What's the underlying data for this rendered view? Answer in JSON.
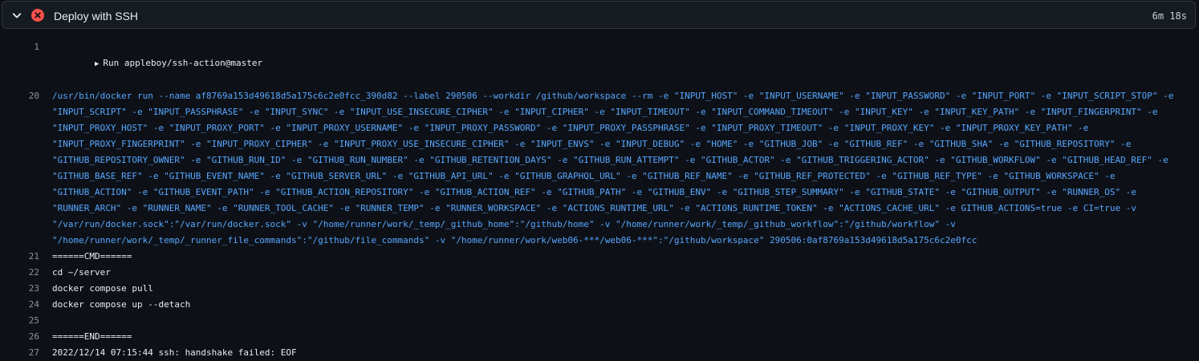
{
  "step": {
    "title": "Deploy with SSH",
    "duration": "6m 18s",
    "status": "failed",
    "status_color": "#f85149",
    "icons": {
      "expand": "chevron-down-icon",
      "status": "x-circle-fill-icon",
      "group": "triangle-right-icon"
    }
  },
  "log": {
    "lines": [
      {
        "number": "1",
        "text": "Run appleboy/ssh-action@master"
      },
      {
        "number": "20",
        "text": "/usr/bin/docker run --name af8769a153d49618d5a175c6c2e0fcc_390d82 --label 290506 --workdir /github/workspace --rm -e \"INPUT_HOST\" -e \"INPUT_USERNAME\" -e \"INPUT_PASSWORD\" -e \"INPUT_PORT\" -e \"INPUT_SCRIPT_STOP\" -e \"INPUT_SCRIPT\" -e \"INPUT_PASSPHRASE\" -e \"INPUT_SYNC\" -e \"INPUT_USE_INSECURE_CIPHER\" -e \"INPUT_CIPHER\" -e \"INPUT_TIMEOUT\" -e \"INPUT_COMMAND_TIMEOUT\" -e \"INPUT_KEY\" -e \"INPUT_KEY_PATH\" -e \"INPUT_FINGERPRINT\" -e \"INPUT_PROXY_HOST\" -e \"INPUT_PROXY_PORT\" -e \"INPUT_PROXY_USERNAME\" -e \"INPUT_PROXY_PASSWORD\" -e \"INPUT_PROXY_PASSPHRASE\" -e \"INPUT_PROXY_TIMEOUT\" -e \"INPUT_PROXY_KEY\" -e \"INPUT_PROXY_KEY_PATH\" -e \"INPUT_PROXY_FINGERPRINT\" -e \"INPUT_PROXY_CIPHER\" -e \"INPUT_PROXY_USE_INSECURE_CIPHER\" -e \"INPUT_ENVS\" -e \"INPUT_DEBUG\" -e \"HOME\" -e \"GITHUB_JOB\" -e \"GITHUB_REF\" -e \"GITHUB_SHA\" -e \"GITHUB_REPOSITORY\" -e \"GITHUB_REPOSITORY_OWNER\" -e \"GITHUB_RUN_ID\" -e \"GITHUB_RUN_NUMBER\" -e \"GITHUB_RETENTION_DAYS\" -e \"GITHUB_RUN_ATTEMPT\" -e \"GITHUB_ACTOR\" -e \"GITHUB_TRIGGERING_ACTOR\" -e \"GITHUB_WORKFLOW\" -e \"GITHUB_HEAD_REF\" -e \"GITHUB_BASE_REF\" -e \"GITHUB_EVENT_NAME\" -e \"GITHUB_SERVER_URL\" -e \"GITHUB_API_URL\" -e \"GITHUB_GRAPHQL_URL\" -e \"GITHUB_REF_NAME\" -e \"GITHUB_REF_PROTECTED\" -e \"GITHUB_REF_TYPE\" -e \"GITHUB_WORKSPACE\" -e \"GITHUB_ACTION\" -e \"GITHUB_EVENT_PATH\" -e \"GITHUB_ACTION_REPOSITORY\" -e \"GITHUB_ACTION_REF\" -e \"GITHUB_PATH\" -e \"GITHUB_ENV\" -e \"GITHUB_STEP_SUMMARY\" -e \"GITHUB_STATE\" -e \"GITHUB_OUTPUT\" -e \"RUNNER_OS\" -e \"RUNNER_ARCH\" -e \"RUNNER_NAME\" -e \"RUNNER_TOOL_CACHE\" -e \"RUNNER_TEMP\" -e \"RUNNER_WORKSPACE\" -e \"ACTIONS_RUNTIME_URL\" -e \"ACTIONS_RUNTIME_TOKEN\" -e \"ACTIONS_CACHE_URL\" -e GITHUB_ACTIONS=true -e CI=true -v \"/var/run/docker.sock\":\"/var/run/docker.sock\" -v \"/home/runner/work/_temp/_github_home\":\"/github/home\" -v \"/home/runner/work/_temp/_github_workflow\":\"/github/workflow\" -v \"/home/runner/work/_temp/_runner_file_commands\":\"/github/file_commands\" -v \"/home/runner/work/web06-***/web06-***\":\"/github/workspace\" 290506:0af8769a153d49618d5a175c6c2e0fcc"
      },
      {
        "number": "21",
        "text": "======CMD======"
      },
      {
        "number": "22",
        "text": "cd ~/server"
      },
      {
        "number": "23",
        "text": "docker compose pull"
      },
      {
        "number": "24",
        "text": "docker compose up --detach"
      },
      {
        "number": "25",
        "text": ""
      },
      {
        "number": "26",
        "text": "======END======"
      },
      {
        "number": "27",
        "text": "2022/12/14 07:15:44 ssh: handshake failed: EOF"
      }
    ]
  }
}
